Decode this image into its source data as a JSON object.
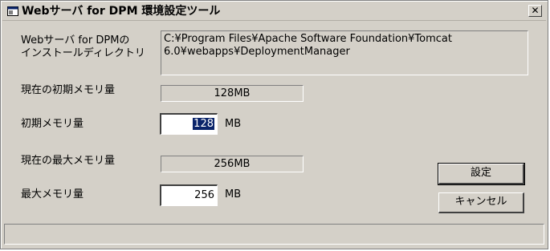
{
  "window": {
    "title": "Webサーバ for DPM 環境設定ツール",
    "close_symbol": "✕"
  },
  "install_dir": {
    "label_line1": "Webサーバ for DPMの",
    "label_line2": "インストールディレクトリ",
    "value_line1": "C:¥Program Files¥Apache Software Foundation¥Tomcat",
    "value_line2": "6.0¥webapps¥DeploymentManager"
  },
  "current_initial_memory": {
    "label": "現在の初期メモリ量",
    "value": "128MB"
  },
  "initial_memory": {
    "label": "初期メモリ量",
    "value": "128",
    "unit": "MB"
  },
  "current_max_memory": {
    "label": "現在の最大メモリ量",
    "value": "256MB"
  },
  "max_memory": {
    "label": "最大メモリ量",
    "value": "256",
    "unit": "MB"
  },
  "buttons": {
    "set_label": "設定",
    "cancel_label": "キャンセル"
  },
  "status": {
    "text": ""
  },
  "icons": {
    "app": "app-window-icon",
    "close": "close-icon"
  }
}
